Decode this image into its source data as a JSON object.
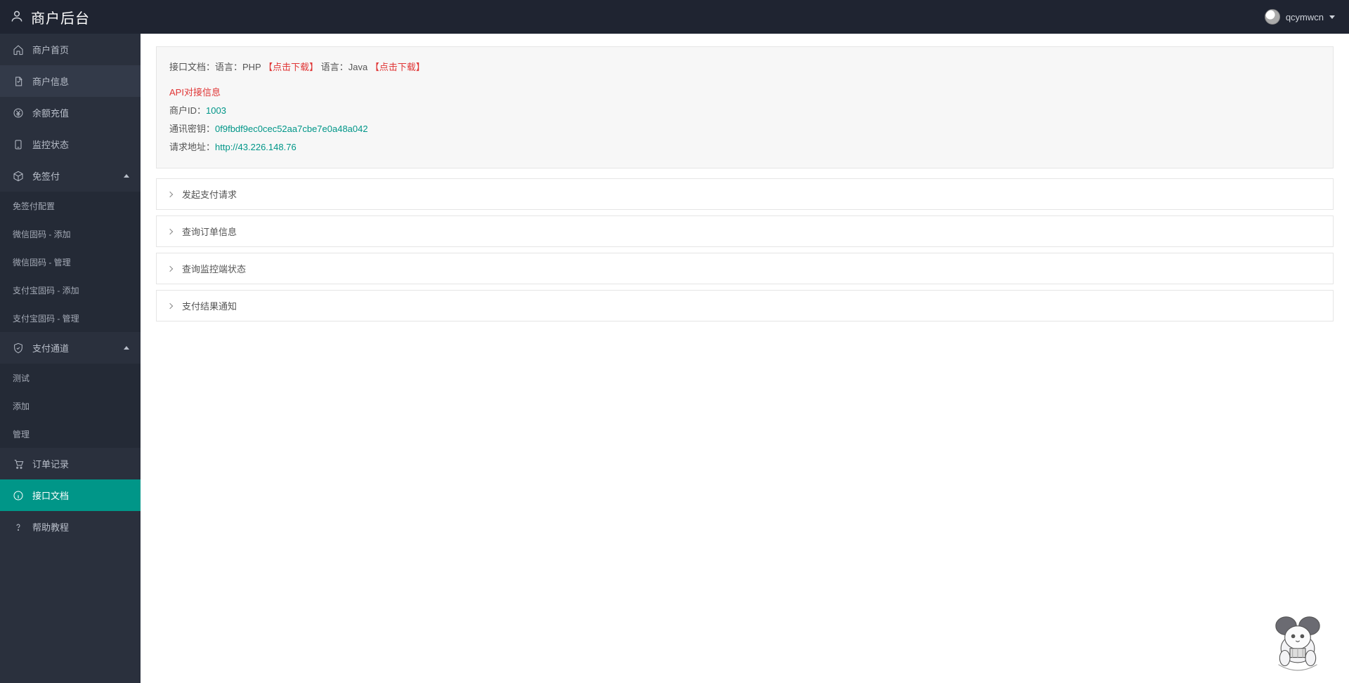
{
  "header": {
    "title": "商户后台",
    "username": "qcymwcn"
  },
  "sidebar": {
    "home": "商户首页",
    "merchant_info": "商户信息",
    "recharge": "余额充值",
    "monitor": "监控状态",
    "sign_free": {
      "label": "免签付",
      "items": [
        "免签付配置",
        "微信固码 - 添加",
        "微信固码 - 管理",
        "支付宝固码 - 添加",
        "支付宝固码 - 管理"
      ]
    },
    "channel": {
      "label": "支付通道",
      "items": [
        "测试",
        "添加",
        "管理"
      ]
    },
    "orders": "订单记录",
    "api_doc": "接口文档",
    "help": "帮助教程"
  },
  "info": {
    "doc_prefix": "接口文档：语言：PHP",
    "download_php": "【点击下载】",
    "lang_java": "语言：Java",
    "download_java": "【点击下载】",
    "api_title": "API对接信息",
    "mid_label": "商户ID：",
    "mid_value": "1003",
    "key_label": "通讯密钥：",
    "key_value": "0f9fbdf9ec0cec52aa7cbe7e0a48a042",
    "url_label": "请求地址：",
    "url_value": "http://43.226.148.76"
  },
  "accordion": [
    "发起支付请求",
    "查询订单信息",
    "查询监控端状态",
    "支付结果通知"
  ]
}
